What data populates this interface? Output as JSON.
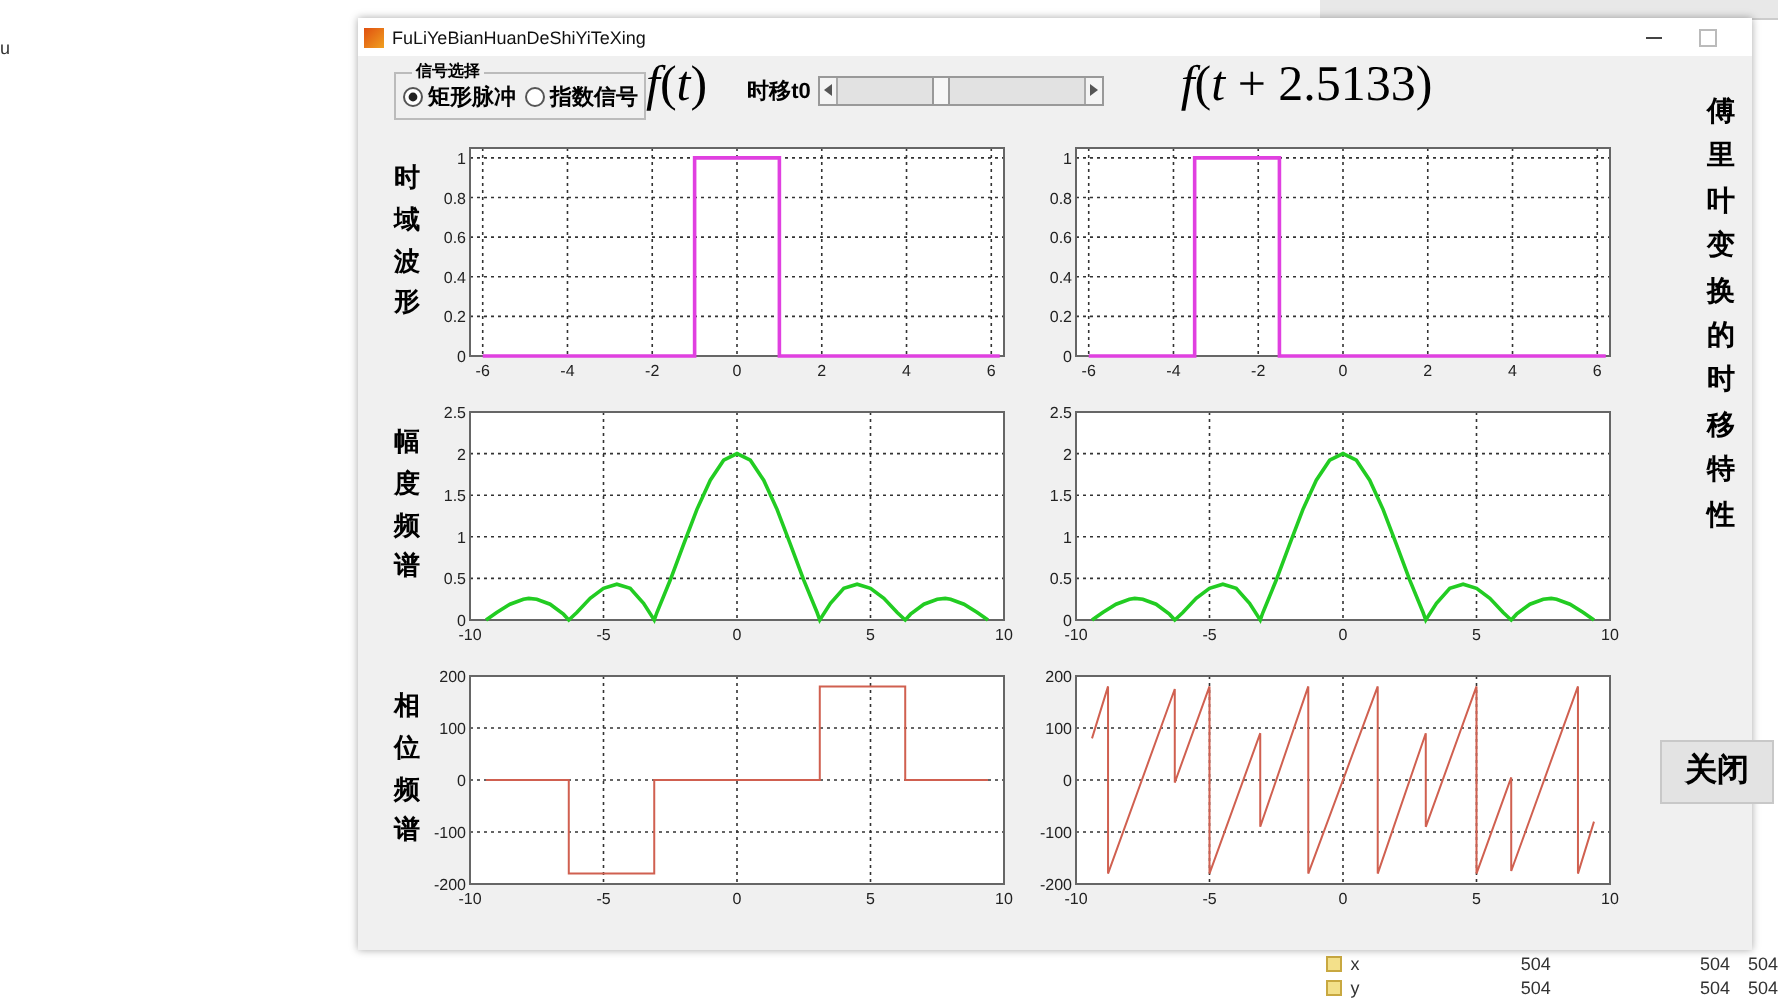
{
  "desktop": {
    "left_text": "u",
    "workspace_rows": [
      {
        "name": "x",
        "values": [
          "504",
          "504",
          "504"
        ]
      },
      {
        "name": "y",
        "values": [
          "504",
          "504",
          "504"
        ]
      }
    ]
  },
  "window": {
    "title": "FuLiYeBianHuanDeShiYiTeXing"
  },
  "signal_group": {
    "title": "信号选择",
    "options": [
      {
        "label": "矩形脉冲",
        "selected": true
      },
      {
        "label": "指数信号",
        "selected": false
      }
    ]
  },
  "original_title": "*f*(*t*)",
  "shift": {
    "label": "时移t0",
    "level": 0.38
  },
  "shifted_title": "*f*(*t* + 2.5133)",
  "row_labels": [
    "时域波形",
    "幅度频谱",
    "相位频谱"
  ],
  "side_title": "傅里叶变换的时移特性",
  "plots": [
    {
      "chart_data": {
        "type": "line",
        "grid": true,
        "x": [
          -6,
          -1,
          -1,
          1,
          1,
          6.2
        ],
        "series": [
          {
            "color": "#e040e0",
            "values": [
              0,
              0,
              1,
              1,
              0,
              0
            ]
          }
        ],
        "xlim": [
          -6.3,
          6.3
        ],
        "ylim": [
          0,
          1.05
        ],
        "xticks": [
          -6,
          -4,
          -2,
          0,
          2,
          4,
          6
        ],
        "yticks": [
          0,
          0.2,
          0.4,
          0.6,
          0.8,
          1
        ]
      }
    },
    {
      "chart_data": {
        "type": "line",
        "grid": true,
        "x": [
          -6,
          -3.5,
          -3.5,
          -1.5,
          -1.5,
          6.2
        ],
        "series": [
          {
            "color": "#e040e0",
            "values": [
              0,
              0,
              1,
              1,
              0,
              0
            ]
          }
        ],
        "xlim": [
          -6.3,
          6.3
        ],
        "ylim": [
          0,
          1.05
        ],
        "xticks": [
          -6,
          -4,
          -2,
          0,
          2,
          4,
          6
        ],
        "yticks": [
          0,
          0.2,
          0.4,
          0.6,
          0.8,
          1
        ]
      }
    },
    {
      "chart_data": {
        "type": "line",
        "grid": true,
        "x": [
          -9.4,
          -9,
          -8.5,
          -8,
          -7.8,
          -7.5,
          -7,
          -6.5,
          -6.3,
          -6,
          -5.5,
          -5,
          -4.5,
          -4,
          -3.5,
          -3.1,
          -3,
          -2.5,
          -2,
          -1.5,
          -1,
          -0.5,
          0,
          0.5,
          1,
          1.5,
          2,
          2.5,
          3,
          3.1,
          3.5,
          4,
          4.5,
          5,
          5.5,
          6,
          6.3,
          6.5,
          7,
          7.5,
          7.8,
          8,
          8.5,
          9,
          9.4
        ],
        "series": [
          {
            "color": "#22cc22",
            "values": [
              0,
              0.09,
              0.19,
              0.25,
              0.26,
              0.25,
              0.19,
              0.07,
              0,
              0.09,
              0.26,
              0.38,
              0.43,
              0.38,
              0.2,
              0,
              0.09,
              0.48,
              0.91,
              1.33,
              1.68,
              1.92,
              2,
              1.92,
              1.68,
              1.33,
              0.91,
              0.48,
              0.09,
              0,
              0.2,
              0.38,
              0.43,
              0.38,
              0.26,
              0.09,
              0,
              0.07,
              0.19,
              0.25,
              0.26,
              0.25,
              0.19,
              0.09,
              0
            ]
          }
        ],
        "xlim": [
          -10,
          10
        ],
        "ylim": [
          0,
          2.5
        ],
        "xticks": [
          -10,
          -5,
          0,
          5,
          10
        ],
        "yticks": [
          0,
          0.5,
          1,
          1.5,
          2,
          2.5
        ]
      }
    },
    {
      "chart_data": {
        "type": "line",
        "grid": true,
        "x": [
          -9.4,
          -9,
          -8.5,
          -8,
          -7.8,
          -7.5,
          -7,
          -6.5,
          -6.3,
          -6,
          -5.5,
          -5,
          -4.5,
          -4,
          -3.5,
          -3.1,
          -3,
          -2.5,
          -2,
          -1.5,
          -1,
          -0.5,
          0,
          0.5,
          1,
          1.5,
          2,
          2.5,
          3,
          3.1,
          3.5,
          4,
          4.5,
          5,
          5.5,
          6,
          6.3,
          6.5,
          7,
          7.5,
          7.8,
          8,
          8.5,
          9,
          9.4
        ],
        "series": [
          {
            "color": "#22cc22",
            "values": [
              0,
              0.09,
              0.19,
              0.25,
              0.26,
              0.25,
              0.19,
              0.07,
              0,
              0.09,
              0.26,
              0.38,
              0.43,
              0.38,
              0.2,
              0,
              0.09,
              0.48,
              0.91,
              1.33,
              1.68,
              1.92,
              2,
              1.92,
              1.68,
              1.33,
              0.91,
              0.48,
              0.09,
              0,
              0.2,
              0.38,
              0.43,
              0.38,
              0.26,
              0.09,
              0,
              0.07,
              0.19,
              0.25,
              0.26,
              0.25,
              0.19,
              0.09,
              0
            ]
          }
        ],
        "xlim": [
          -10,
          10
        ],
        "ylim": [
          0,
          2.5
        ],
        "xticks": [
          -10,
          -5,
          0,
          5,
          10
        ],
        "yticks": [
          0,
          0.5,
          1,
          1.5,
          2,
          2.5
        ]
      }
    },
    {
      "chart_data": {
        "type": "line",
        "grid": true,
        "x": [
          -9.4,
          -6.3,
          -6.3,
          -3.1,
          -3.1,
          3.1,
          3.1,
          6.3,
          6.3,
          9.4
        ],
        "series": [
          {
            "color": "#d06050",
            "values": [
              0,
              0,
              -180,
              -180,
              0,
              0,
              180,
              180,
              0,
              0
            ]
          }
        ],
        "xlim": [
          -10,
          10
        ],
        "ylim": [
          -200,
          200
        ],
        "xticks": [
          -10,
          -5,
          0,
          5,
          10
        ],
        "yticks": [
          -200,
          -100,
          0,
          100,
          200
        ]
      }
    },
    {
      "chart_data": {
        "type": "line",
        "grid": true,
        "x": [
          -9.4,
          -8.8,
          -8.8,
          -6.3,
          -6.3,
          -5,
          -5,
          -3.1,
          -3.1,
          -1.3,
          -1.3,
          1.3,
          1.3,
          3.1,
          3.1,
          5,
          5,
          6.3,
          6.3,
          8.8,
          8.8,
          9.4
        ],
        "series": [
          {
            "color": "#d06050",
            "values": [
              80,
              180,
              -180,
              175,
              -5,
              180,
              -180,
              90,
              -90,
              180,
              -180,
              180,
              -180,
              90,
              -90,
              180,
              -180,
              5,
              -175,
              180,
              -180,
              -80
            ]
          }
        ],
        "xlim": [
          -10,
          10
        ],
        "ylim": [
          -200,
          200
        ],
        "xticks": [
          -10,
          -5,
          0,
          5,
          10
        ],
        "yticks": [
          -200,
          -100,
          0,
          100,
          200
        ]
      }
    }
  ],
  "close_button": "关闭"
}
